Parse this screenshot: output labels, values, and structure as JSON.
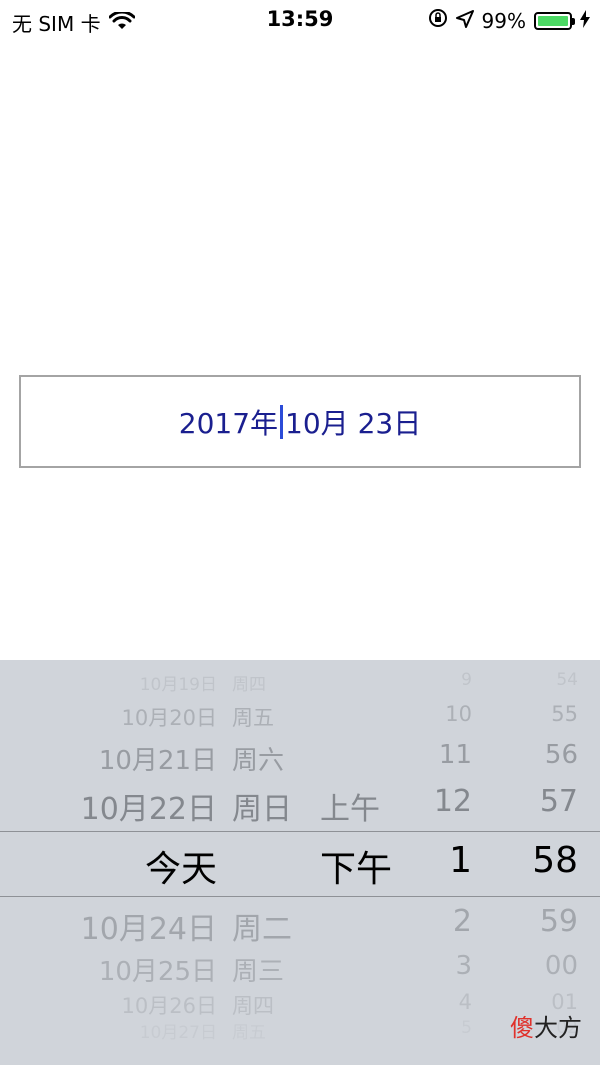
{
  "status_bar": {
    "carrier": "无 SIM 卡",
    "time": "13:59",
    "battery": "99%",
    "icons": [
      "wifi-icon",
      "orientation-lock-icon",
      "location-arrow-icon",
      "battery-icon",
      "charging-bolt-icon"
    ]
  },
  "date_field": {
    "value_before_caret": "2017年",
    "value_after_caret": "10月 23日"
  },
  "picker": {
    "rows": [
      {
        "date": "10月19日",
        "weekday": "周四",
        "ampm": "",
        "hour": "9",
        "minute": "54",
        "opacity": 0.15
      },
      {
        "date": "10月20日",
        "weekday": "周五",
        "ampm": "",
        "hour": "10",
        "minute": "55",
        "opacity": 0.35
      },
      {
        "date": "10月21日",
        "weekday": "周六",
        "ampm": "",
        "hour": "11",
        "minute": "56",
        "opacity": 0.55
      },
      {
        "date": "10月22日",
        "weekday": "周日",
        "ampm": "上午",
        "hour": "12",
        "minute": "57",
        "opacity": 0.75
      },
      {
        "date": "今天",
        "weekday": "",
        "ampm": "下午",
        "hour": "1",
        "minute": "58",
        "opacity": 1,
        "selected": true
      },
      {
        "date": "10月24日",
        "weekday": "周二",
        "ampm": "",
        "hour": "2",
        "minute": "59",
        "opacity": 0.45
      },
      {
        "date": "10月25日",
        "weekday": "周三",
        "ampm": "",
        "hour": "3",
        "minute": "00",
        "opacity": 0.35
      },
      {
        "date": "10月26日",
        "weekday": "周四",
        "ampm": "",
        "hour": "4",
        "minute": "01",
        "opacity": 0.2
      },
      {
        "date": "10月27日",
        "weekday": "周五",
        "ampm": "",
        "hour": "5",
        "minute": "02",
        "opacity": 0.08
      }
    ]
  },
  "watermark": {
    "char_red": "傻",
    "text_rest": "大方"
  },
  "colors": {
    "field_text": "#1a1f8f",
    "caret": "#2b4bd8",
    "picker_bg": "#d0d4da",
    "selected_text": "#000000",
    "faded_text": "#6b6f75",
    "battery_fill": "#4cd964",
    "watermark_red": "#e0312b",
    "watermark_text": "#222222"
  }
}
